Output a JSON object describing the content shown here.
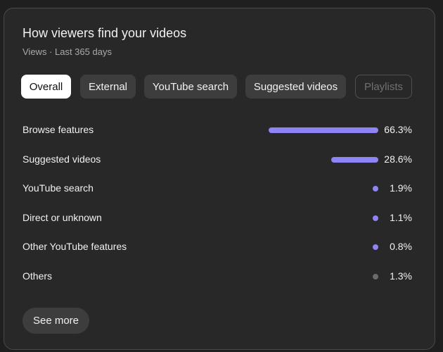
{
  "card": {
    "title": "How viewers find your videos",
    "subtitle": "Views · Last 365 days"
  },
  "tabs": [
    {
      "label": "Overall",
      "state": "active"
    },
    {
      "label": "External",
      "state": "normal"
    },
    {
      "label": "YouTube search",
      "state": "normal"
    },
    {
      "label": "Suggested videos",
      "state": "normal"
    },
    {
      "label": "Playlists",
      "state": "disabled"
    }
  ],
  "sources": [
    {
      "label": "Browse features",
      "value": "66.3%",
      "percent": 66.3,
      "color": "#8e84f5"
    },
    {
      "label": "Suggested videos",
      "value": "28.6%",
      "percent": 28.6,
      "color": "#8e84f5"
    },
    {
      "label": "YouTube search",
      "value": "1.9%",
      "percent": 1.9,
      "color": "#8e84f5"
    },
    {
      "label": "Direct or unknown",
      "value": "1.1%",
      "percent": 1.1,
      "color": "#8e84f5"
    },
    {
      "label": "Other YouTube features",
      "value": "0.8%",
      "percent": 0.8,
      "color": "#8e84f5"
    },
    {
      "label": "Others",
      "value": "1.3%",
      "percent": 1.3,
      "color": "#6b6b6b"
    }
  ],
  "see_more_label": "See more"
}
